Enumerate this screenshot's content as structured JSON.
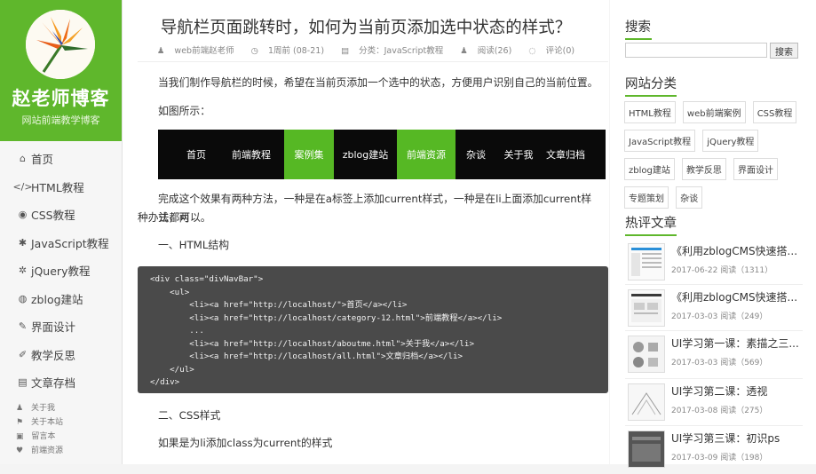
{
  "brand": {
    "title": "赵老师博客",
    "subtitle": "网站前端教学博客"
  },
  "nav": [
    {
      "label": "首页",
      "icon": "home-icon",
      "glyph": "⌂"
    },
    {
      "label": "HTML教程",
      "icon": "code-icon",
      "glyph": "</>"
    },
    {
      "label": "CSS教程",
      "icon": "eye-icon",
      "glyph": "◉"
    },
    {
      "label": "JavaScript教程",
      "icon": "gear-icon",
      "glyph": "✱"
    },
    {
      "label": "jQuery教程",
      "icon": "cogs-icon",
      "glyph": "✲"
    },
    {
      "label": "zblog建站",
      "icon": "globe-icon",
      "glyph": "◍"
    },
    {
      "label": "界面设计",
      "icon": "magic-icon",
      "glyph": "✎"
    },
    {
      "label": "教学反思",
      "icon": "pencil-icon",
      "glyph": "✐"
    },
    {
      "label": "文章存档",
      "icon": "archive-icon",
      "glyph": "▤"
    }
  ],
  "footer_links": [
    {
      "label": "关于我",
      "icon": "user-icon",
      "glyph": "♟"
    },
    {
      "label": "关于本站",
      "icon": "flag-icon",
      "glyph": "⚑"
    },
    {
      "label": "留言本",
      "icon": "book-icon",
      "glyph": "▣"
    },
    {
      "label": "前端资源",
      "icon": "heart-icon",
      "glyph": "♥"
    }
  ],
  "post": {
    "title": "导航栏页面跳转时，如何为当前页添加选中状态的样式？",
    "meta": {
      "author": "web前端赵老师",
      "time": "1周前 (08-21)",
      "category": "分类：JavaScript教程",
      "reads": "阅读(26)",
      "comments": "评论(0)"
    },
    "p1": "当我们制作导航栏的时候，希望在当前页添加一个选中的状态，方便用户识别自己的当前位置。",
    "p2": "如图所示：",
    "demo_nav": [
      {
        "label": "首页",
        "active": false
      },
      {
        "label": "前端教程",
        "active": false
      },
      {
        "label": "案例集",
        "active": true
      },
      {
        "label": "zblog建站",
        "active": false
      },
      {
        "label": "前端资源",
        "active": true
      },
      {
        "label": "杂谈",
        "active": false
      },
      {
        "label": "关于我",
        "active": false
      },
      {
        "label": "文章归档",
        "active": false
      }
    ],
    "p3a": "完成这个效果有两种方法，一种是在a标签上添加current样式，一种是在li上面添加current样式，两",
    "p3b": "种办法都可以。",
    "h1": "一、HTML结构",
    "code": [
      "<div class=\"divNavBar\">",
      "    <ul>",
      "        <li><a href=\"http://localhost/\">首页</a></li>",
      "        <li><a href=\"http://localhost/category-12.html\">前端教程</a></li>",
      "        ...",
      "        <li><a href=\"http://localhost/aboutme.html\">关于我</a></li>",
      "        <li><a href=\"http://localhost/all.html\">文章归档</a></li>",
      "    </ul>",
      "</div>"
    ],
    "h2": "二、CSS样式",
    "p4": "如果是为li添加class为current的样式"
  },
  "right": {
    "search_title": "搜索",
    "search_button": "搜索",
    "cat_title": "网站分类",
    "tags": [
      "HTML教程",
      "web前端案例",
      "CSS教程",
      "JavaScript教程",
      "jQuery教程",
      "zblog建站",
      "教学反思",
      "界面设计",
      "专题策划",
      "杂谈"
    ],
    "hot_title": "热评文章",
    "articles": [
      {
        "title": "《利用zblogCMS快速搭...",
        "date": "2017-06-22",
        "reads": "阅读（1311）"
      },
      {
        "title": "《利用zblogCMS快速搭...",
        "date": "2017-03-03",
        "reads": "阅读（249）"
      },
      {
        "title": "UI学习第一课：素描之三...",
        "date": "2017-03-03",
        "reads": "阅读（569）"
      },
      {
        "title": "UI学习第二课：透视",
        "date": "2017-03-08",
        "reads": "阅读（275）"
      },
      {
        "title": "UI学习第三课：初识ps",
        "date": "2017-03-09",
        "reads": "阅读（198）"
      }
    ]
  }
}
